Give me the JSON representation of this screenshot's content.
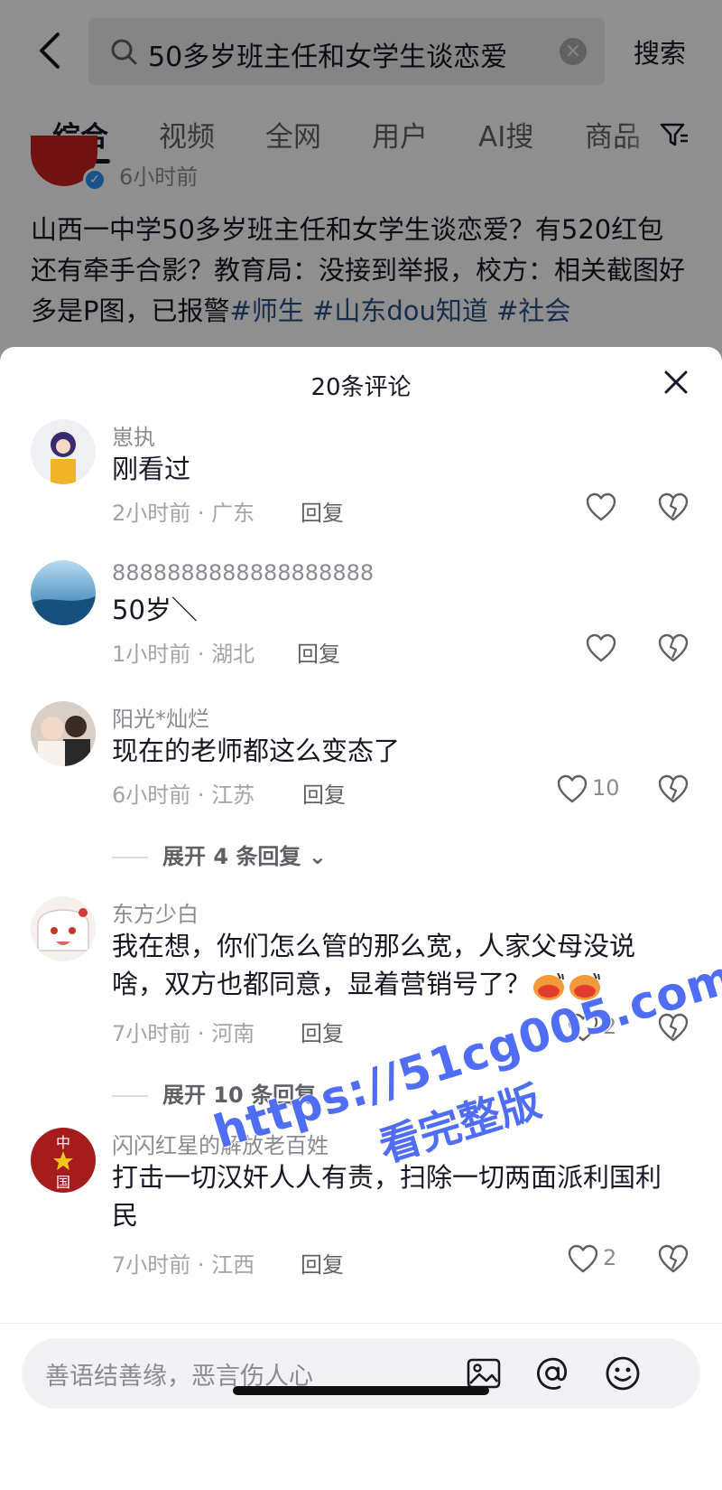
{
  "search": {
    "query": "50多岁班主任和女学生谈恋爱",
    "search_button": "搜索",
    "back_icon": "chevron-left-icon",
    "clear_icon": "clear-icon"
  },
  "tabs": [
    {
      "label": "综合",
      "active": true
    },
    {
      "label": "视频",
      "active": false
    },
    {
      "label": "全网",
      "active": false
    },
    {
      "label": "用户",
      "active": false
    },
    {
      "label": "AI搜",
      "active": false
    },
    {
      "label": "商品",
      "active": false
    }
  ],
  "post": {
    "time": "6小时前",
    "text": "山西一中学50多岁班主任和女学生谈恋爱？有520红包还有牵手合影？教育局：没接到举报，校方：相关截图好多是P图，已报警",
    "hashtags": [
      "#师生",
      "#山东dou知道",
      "#社会"
    ]
  },
  "comments_sheet": {
    "title": "20条评论",
    "reply_label": "回复",
    "comments": [
      {
        "user": "崽执",
        "text": "刚看过",
        "meta": "2小时前 · 广东",
        "likes": ""
      },
      {
        "user": "8888888888888888888",
        "text": "50岁＼",
        "meta": "1小时前 · 湖北",
        "likes": ""
      },
      {
        "user": "阳光*灿烂",
        "text": "现在的老师都这么变态了",
        "meta": "6小时前 · 江苏",
        "likes": "10",
        "expand": "展开 4 条回复"
      },
      {
        "user": "东方少白",
        "text": "我在想，你们怎么管的那么宽，人家父母没说啥，双方也都同意，显着营销号了？",
        "meta": "7小时前 · 河南",
        "likes": "2",
        "expand": "展开 10 条回复"
      },
      {
        "user": "闪闪红星的解放老百姓",
        "text": "打击一切汉奸人人有责，扫除一切两面派利国利民",
        "meta": "7小时前 · 江西",
        "likes": "2"
      }
    ]
  },
  "watermark": {
    "url": "https://51cg005.com",
    "text": "看完整版"
  },
  "input": {
    "placeholder": "善语结善缘，恶言伤人心"
  },
  "colors": {
    "hashtag": "#2a4f86",
    "watermark": "#4f6df5",
    "verify_badge": "#2d8cf0"
  }
}
